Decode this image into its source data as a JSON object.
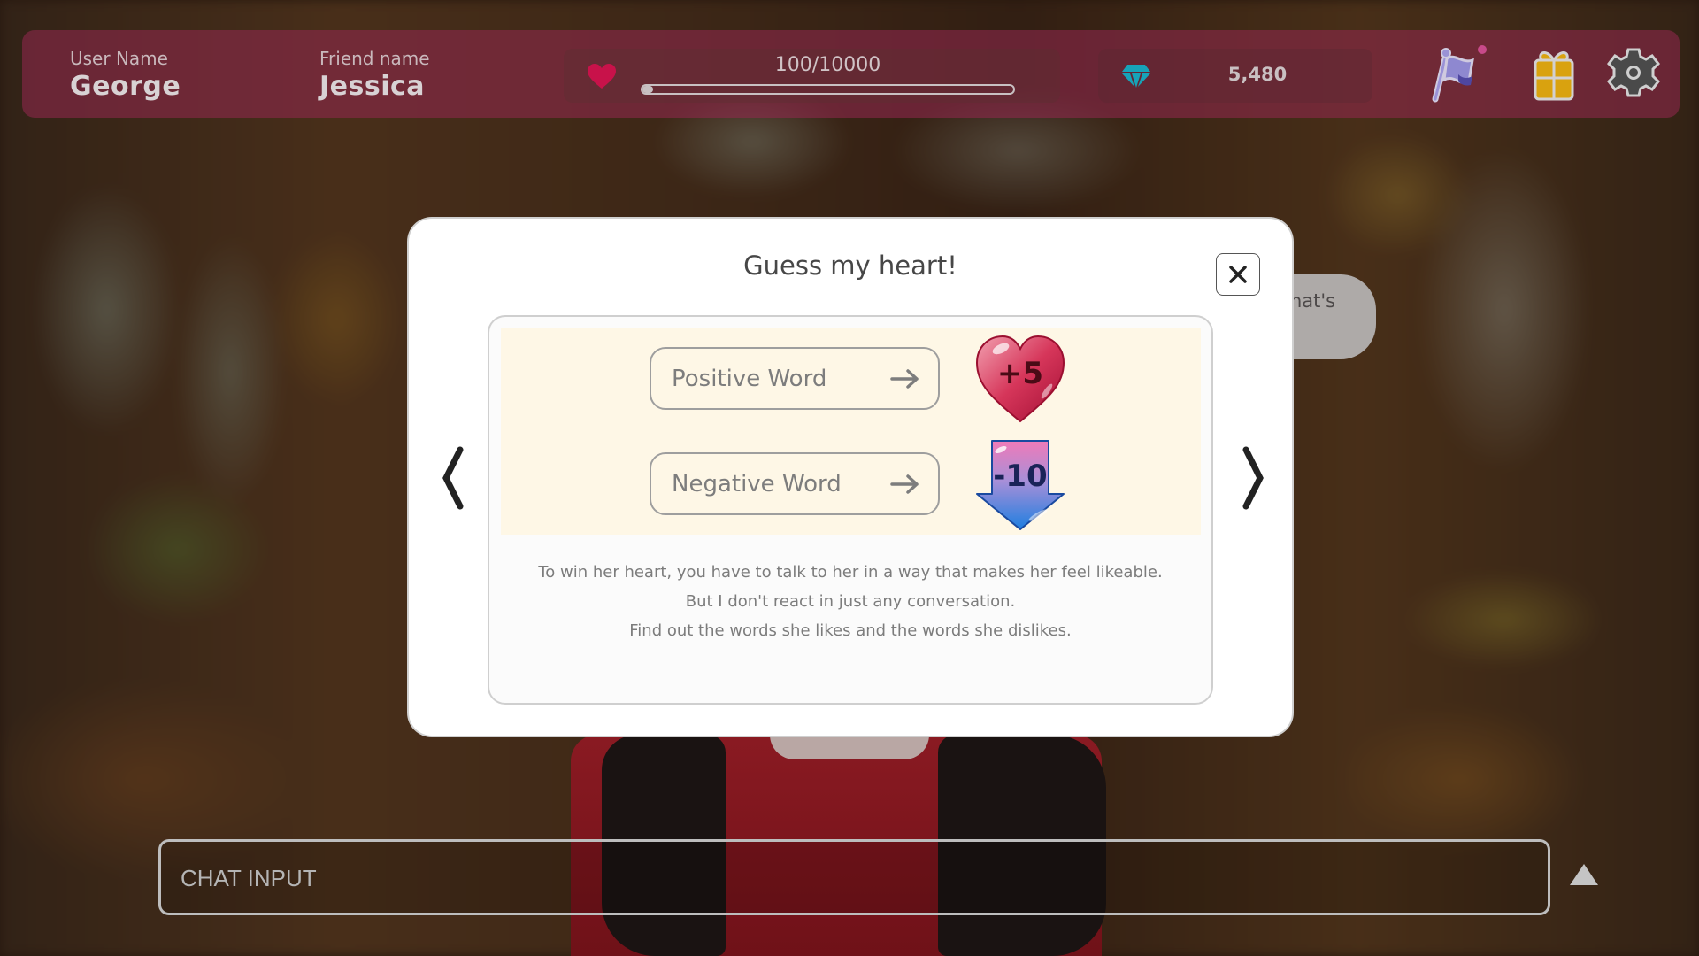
{
  "header": {
    "user_label": "User Name",
    "user_name": "George",
    "friend_label": "Friend name",
    "friend_name": "Jessica",
    "affection": {
      "icon": "heart-icon",
      "current": 100,
      "max": 10000,
      "text": "100/10000",
      "progress_fraction": 0.01,
      "color": "#c8124a"
    },
    "gems": {
      "icon": "diamond-icon",
      "count": "5,480",
      "color": "#17a3b8"
    },
    "buttons": [
      {
        "name": "flag-icon",
        "has_notification": true
      },
      {
        "name": "gift-icon"
      },
      {
        "name": "gear-icon"
      }
    ]
  },
  "speech_bubble": {
    "visible_text": "hat's"
  },
  "modal": {
    "title": "Guess my heart!",
    "close_icon": "close-icon",
    "prev_icon": "chevron-left-icon",
    "next_icon": "chevron-right-icon",
    "rows": [
      {
        "label": "Positive Word",
        "badge": "+5",
        "badge_icon": "heart-badge-icon",
        "badge_color": "#d0294a"
      },
      {
        "label": "Negative Word",
        "badge": "-10",
        "badge_icon": "down-arrow-badge-icon",
        "badge_color": "#2a7de0"
      }
    ],
    "description": [
      "To win her heart, you have to talk to her in a way that makes her feel likeable.",
      "But I don't react in just any conversation.",
      "Find out the words she likes and the words she dislikes."
    ]
  },
  "chat": {
    "placeholder": "CHAT INPUT",
    "send_icon": "triangle-up-icon"
  }
}
